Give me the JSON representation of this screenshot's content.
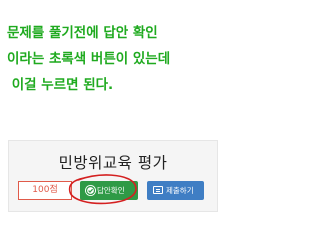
{
  "instruction": {
    "line1": "문제를 풀기전에 답안 확인",
    "line2": "이라는 초록색 버튼이 있는데",
    "line3": " 이걸 누르면 된다."
  },
  "quiz": {
    "title": "민방위교육 평가",
    "score": "100점",
    "check_answer_label": "답안확인",
    "submit_label": "제출하기"
  },
  "colors": {
    "instruction_text": "#1faa1f",
    "check_button": "#2f9a46",
    "submit_button": "#3f7ec4",
    "score_text": "#e05a4a",
    "highlight_circle": "#d42020"
  }
}
